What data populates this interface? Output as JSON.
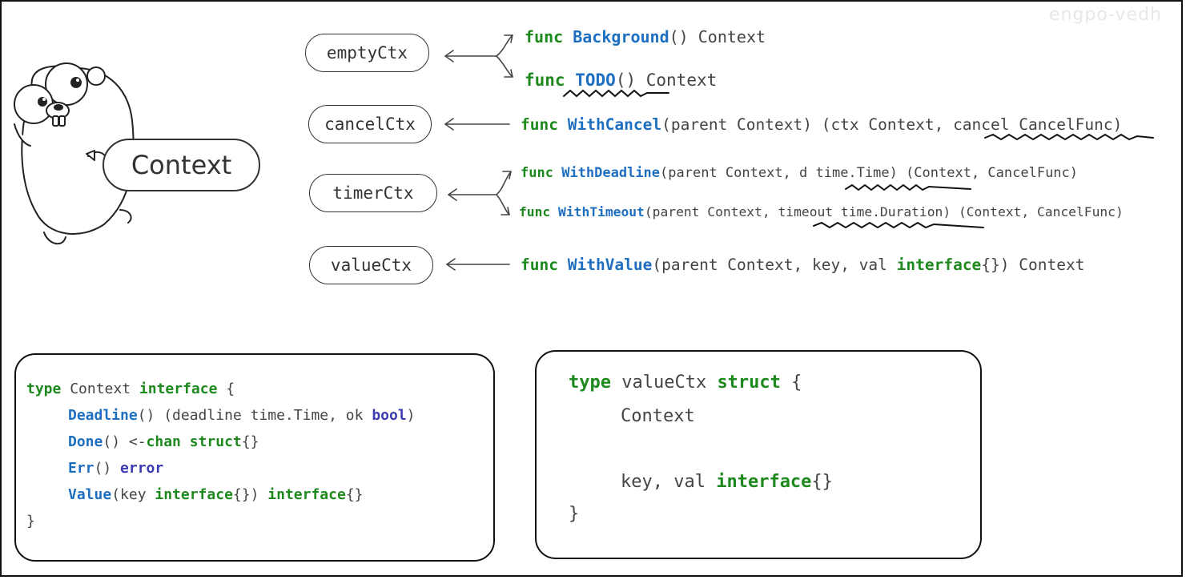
{
  "watermark": "engpo-vedh",
  "mascot": {
    "label": "Context"
  },
  "types": {
    "empty": "emptyCtx",
    "cancel": "cancelCtx",
    "timer": "timerCtx",
    "value": "valueCtx"
  },
  "functions": {
    "background": {
      "kw": "func",
      "name": "Background",
      "rest": "() Context"
    },
    "todo": {
      "kw": "func",
      "name": "TODO",
      "rest": "() Context"
    },
    "with_cancel": {
      "kw": "func",
      "name": "WithCancel",
      "rest": "(parent Context) (ctx Context, cancel CancelFunc)"
    },
    "with_deadline": {
      "kw": "func",
      "name": "WithDeadline",
      "rest": "(parent Context, d time.Time) (Context, CancelFunc)"
    },
    "with_timeout": {
      "kw": "func",
      "name": "WithTimeout",
      "rest": "(parent Context, timeout time.Duration) (Context, CancelFunc)"
    },
    "with_value": {
      "kw": "func",
      "name": "WithValue",
      "rest1": "(parent Context, key, val ",
      "iface": "interface",
      "rest2": "{}) Context"
    }
  },
  "context_interface": {
    "l1_type": "type",
    "l1_name": " Context ",
    "l1_iface": "interface",
    "l1_brace": " {",
    "deadline_name": "Deadline",
    "deadline_rest": "() (deadline time.Time, ok ",
    "deadline_bool": "bool",
    "deadline_close": ")",
    "done_name": "Done",
    "done_rest": "() <-",
    "done_chan": "chan",
    "done_sp": " ",
    "done_struct": "struct",
    "done_end": "{}",
    "err_name": "Err",
    "err_rest": "() ",
    "err_type": "error",
    "value_name": "Value",
    "value_rest1": "(key ",
    "value_iface1": "interface",
    "value_rest2": "{}) ",
    "value_iface2": "interface",
    "value_end": "{}",
    "close": "}"
  },
  "value_ctx_struct": {
    "l1_type": "type",
    "l1_name": " valueCtx ",
    "l1_struct": "struct",
    "l1_brace": " {",
    "context": "Context",
    "fields": "key, val ",
    "fields_iface": "interface",
    "fields_end": "{}",
    "close": "}"
  },
  "colors": {
    "keyword": "#1e8a1e",
    "function": "#1f6fc0",
    "builtin_type": "#3b3bb0",
    "text": "#444444"
  }
}
